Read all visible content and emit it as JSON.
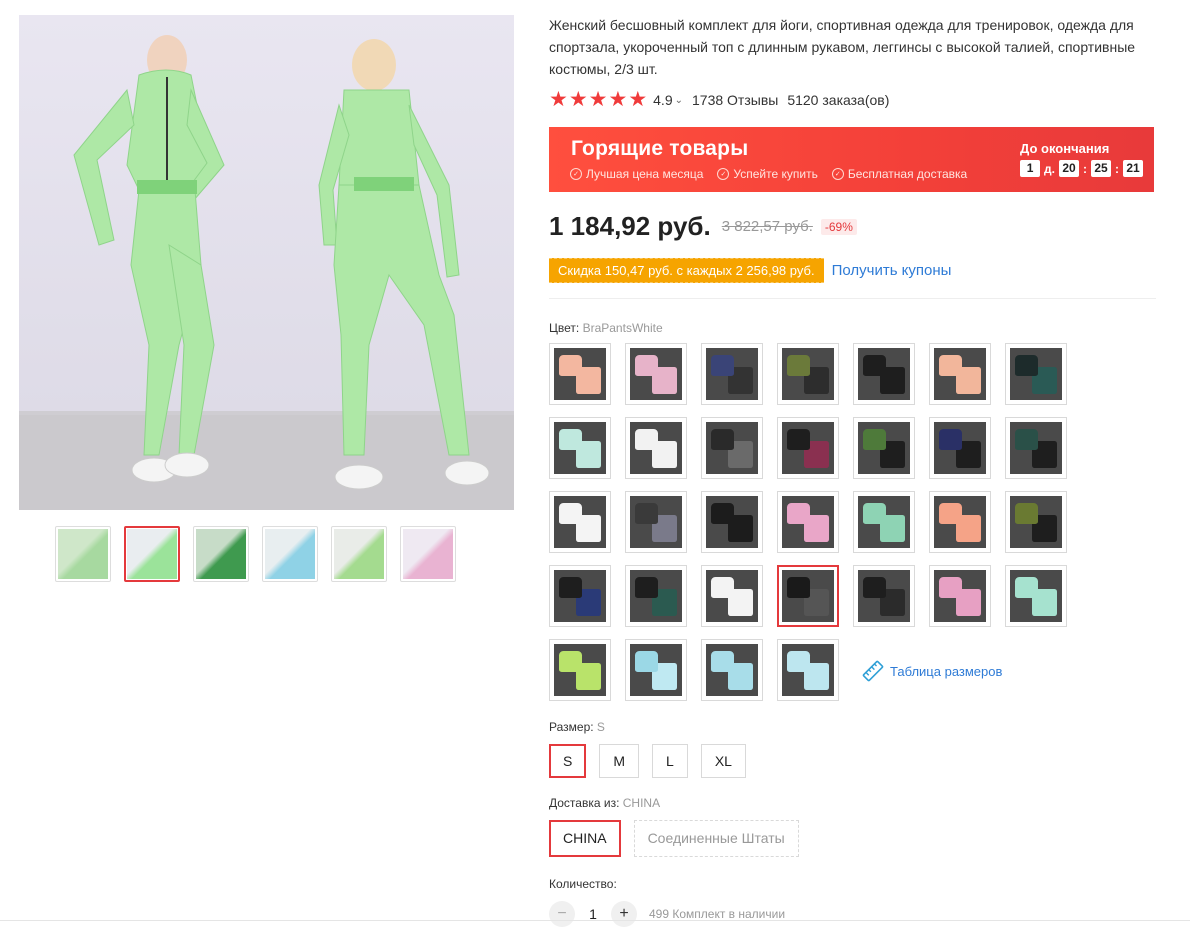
{
  "product": {
    "title": "Женский бесшовный комплект для йоги, спортивная одежда для тренировок, одежда для спортзала, укороченный топ с длинным рукавом, леггинсы с высокой талией, спортивные костюмы, 2/3 шт.",
    "rating": "4.9",
    "reviews": "1738 Отзывы",
    "orders": "5120 заказа(ов)",
    "stars": 5
  },
  "hot_deal": {
    "title": "Горящие товары",
    "features": [
      "Лучшая цена месяца",
      "Успейте купить",
      "Бесплатная доставка"
    ],
    "ends_label": "До окончания",
    "days": "1",
    "days_unit": "д.",
    "hours": "20",
    "minutes": "25",
    "seconds": "21",
    "sep": ":"
  },
  "price": {
    "current": "1 184,92 руб.",
    "old": "3 822,57 руб.",
    "discount": "-69%"
  },
  "coupon": {
    "text": "Скидка 150,47 руб. с каждых 2 256,98 руб.",
    "link": "Получить купоны"
  },
  "color": {
    "label": "Цвет:",
    "selected": "BraPantsWhite",
    "selected_index": 24,
    "swatch_colors": [
      [
        "#f3b7a0",
        "#f3b7a0"
      ],
      [
        "#e7b3c9",
        "#e7b3c9"
      ],
      [
        "#3a4477",
        "#333"
      ],
      [
        "#6b7a3a",
        "#2d2d2d"
      ],
      [
        "#1e1e1e",
        "#1e1e1e"
      ],
      [
        "#f2b69b",
        "#f2b69b"
      ],
      [
        "#1d2b2b",
        "#2a5a55"
      ],
      [
        "#bfe8de",
        "#bfe8de"
      ],
      [
        "#f2f2f2",
        "#f2f2f2"
      ],
      [
        "#2a2a2a",
        "#6a6a6a"
      ],
      [
        "#1e1e1e",
        "#8a3050"
      ],
      [
        "#4e7a3a",
        "#1e1e1e"
      ],
      [
        "#2a3066",
        "#1e1e1e"
      ],
      [
        "#2a5048",
        "#1e1e1e"
      ],
      [
        "#f4f4f4",
        "#f4f4f4"
      ],
      [
        "#3a3a3a",
        "#7a7a8a"
      ],
      [
        "#1c1c1c",
        "#1c1c1c"
      ],
      [
        "#e9a6c8",
        "#e9a6c8"
      ],
      [
        "#8ed3b4",
        "#8ed3b4"
      ],
      [
        "#f5a387",
        "#f5a387"
      ],
      [
        "#6a7a32",
        "#1e1e1e"
      ],
      [
        "#1e1e1e",
        "#2a3a77"
      ],
      [
        "#1e1e1e",
        "#2b5a50"
      ],
      [
        "#f3f3f3",
        "#f3f3f3"
      ],
      [
        "#1a1a1a",
        "#555"
      ],
      [
        "#1e1e1e",
        "#2b2b2b"
      ],
      [
        "#e7a0c3",
        "#e7a0c3"
      ],
      [
        "#a6e2cf",
        "#a6e2cf"
      ],
      [
        "#b9e36a",
        "#b9e36a"
      ],
      [
        "#9bd8e6",
        "#bfe9f2"
      ],
      [
        "#a8dde9",
        "#a8dde9"
      ],
      [
        "#bde6ef",
        "#bde6ef"
      ]
    ],
    "size_chart": "Таблица размеров"
  },
  "size": {
    "label": "Размер:",
    "selected": "S",
    "options": [
      "S",
      "M",
      "L",
      "XL"
    ]
  },
  "shipping": {
    "label": "Доставка из:",
    "selected": "CHINA",
    "options": [
      "CHINA",
      "Соединенные Штаты"
    ]
  },
  "quantity": {
    "label": "Количество:",
    "value": "1",
    "minus": "−",
    "plus": "+",
    "stock": "499 Комплект в наличии"
  },
  "gallery": {
    "thumb_count": 6,
    "active_thumb": 1,
    "thumb_colors": [
      [
        "#cfe7c9",
        "#a7d9a0"
      ],
      [
        "#e9edf0",
        "#9be39a"
      ],
      [
        "#c7dcc8",
        "#3f9a4f"
      ],
      [
        "#e8eef0",
        "#8fd2e6"
      ],
      [
        "#e9ece8",
        "#a4db8f"
      ],
      [
        "#efe9f2",
        "#e9b3d2"
      ]
    ]
  }
}
